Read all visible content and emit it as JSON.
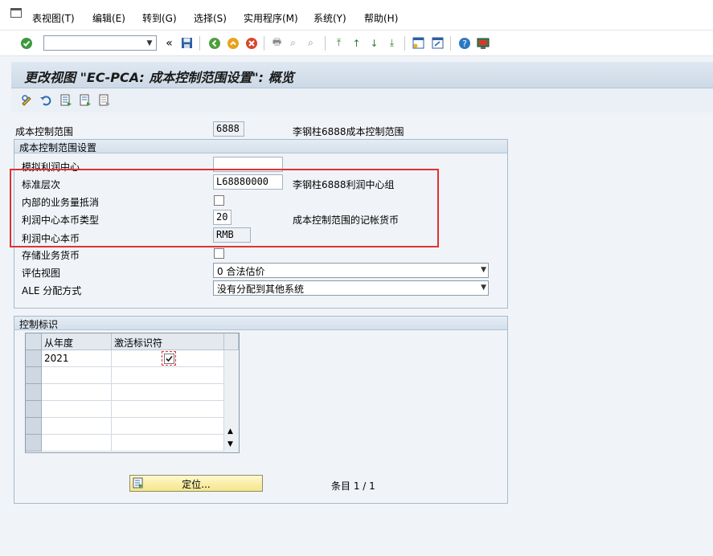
{
  "menu": [
    "表视图(T)",
    "编辑(E)",
    "转到(G)",
    "选择(S)",
    "实用程序(M)",
    "系统(Y)",
    "帮助(H)"
  ],
  "toolbar": {
    "back_chevrons": "«"
  },
  "title": "更改视图 \"EC-PCA: 成本控制范围设置\": 概览",
  "header": {
    "cca_label": "成本控制范围",
    "cca_value": "6888",
    "cca_desc": "李钢柱6888成本控制范围"
  },
  "settings_group": {
    "title": "成本控制范围设置",
    "dummy_pc_label": "模拟利润中心",
    "dummy_pc_value": "",
    "std_hier_label": "标准层次",
    "std_hier_value": "L68880000",
    "std_hier_desc": "李钢柱6888利润中心组",
    "elim_label": "内部的业务量抵消",
    "pc_curr_type_label": "利润中心本币类型",
    "pc_curr_type_value": "20",
    "pc_curr_type_desc": "成本控制范围的记帐货币",
    "pc_curr_label": "利润中心本币",
    "pc_curr_value": "RMB",
    "store_txn_label": "存储业务货币",
    "valuation_label": "评估视图",
    "valuation_value": "0 合法估价",
    "ale_label": "ALE 分配方式",
    "ale_value": "没有分配到其他系统"
  },
  "control_group": {
    "title": "控制标识",
    "columns": [
      "从年度",
      "激活标识符"
    ],
    "rows": [
      {
        "year": "2021",
        "active": true
      }
    ]
  },
  "footer": {
    "position_button": "定位...",
    "entry_label": "条目 1 / 1"
  }
}
